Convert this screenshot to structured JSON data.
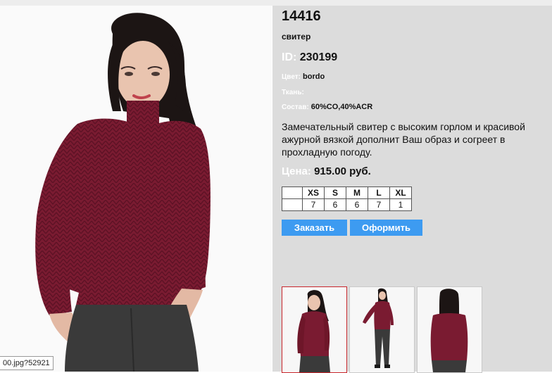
{
  "product": {
    "sku": "14416",
    "type": "свитер",
    "id_label": "ID:",
    "id_value": "230199",
    "color_label": "Цвет:",
    "color_value": "bordo",
    "fabric_label": "Ткань:",
    "fabric_value": "",
    "composition_label": "Состав:",
    "composition_value": "60%CO,40%ACR",
    "description": "Замечательный свитер с высоким горлом и красивой ажурной вязкой дополнит Ваш образ и согреет в прохладную погоду.",
    "price_label": "Цена:",
    "price_value": "915.00 руб."
  },
  "sizes": {
    "headers": [
      "XS",
      "S",
      "M",
      "L",
      "XL"
    ],
    "quantities": [
      "7",
      "6",
      "6",
      "7",
      "1"
    ]
  },
  "buttons": {
    "order": "Заказать",
    "checkout": "Оформить"
  },
  "status_tip": "00.jpg?52921",
  "colors": {
    "panel_bg": "#dcdcdc",
    "button_bg": "#3d9bf1",
    "sweater": "#7a1b31",
    "active_thumb_border": "#c8262c"
  },
  "images": {
    "main": "model-front-photo",
    "thumbnails": [
      "thumb-front",
      "thumb-full-length",
      "thumb-back"
    ]
  }
}
